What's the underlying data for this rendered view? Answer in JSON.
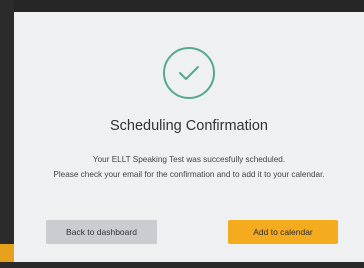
{
  "modal": {
    "title": "Scheduling Confirmation",
    "message_line1": "Your ELLT Speaking Test was succesfully scheduled.",
    "message_line2": "Please check your email for the confirmation and to add it to your calendar.",
    "icon": "check-circle-icon",
    "accent_color": "#57a98b"
  },
  "buttons": {
    "back_label": "Back to dashboard",
    "add_label": "Add to calendar",
    "add_color": "#f4ac1e"
  }
}
